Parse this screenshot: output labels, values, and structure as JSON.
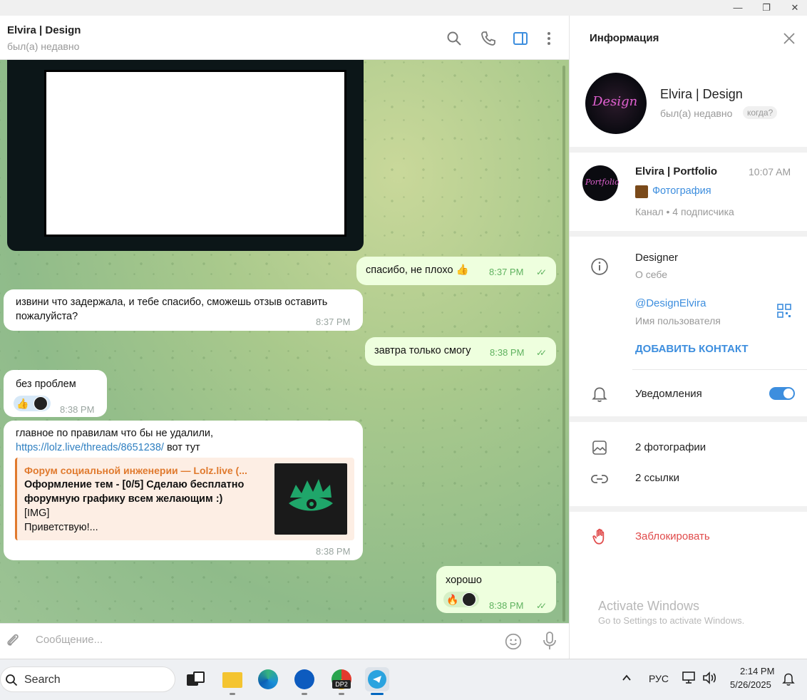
{
  "window": {
    "min": "—",
    "max": "❐",
    "close": "✕"
  },
  "chat": {
    "name": "Elvira | Design",
    "status": "был(а) недавно",
    "composer_placeholder": "Сообщение..."
  },
  "messages": [
    {
      "id": "m1",
      "dir": "out",
      "text": "спасибо, не плохо 👍",
      "time": "8:37 PM"
    },
    {
      "id": "m2",
      "dir": "in",
      "text_line1": "извини что задержала, и тебе спасибо, сможешь отзыв оставить",
      "text_line2": "пожалуйста?",
      "time": "8:37 PM"
    },
    {
      "id": "m3",
      "dir": "out",
      "text": "завтра только смогу",
      "time": "8:38 PM"
    },
    {
      "id": "m4",
      "dir": "in",
      "text": "без проблем",
      "reaction": "👍",
      "time": "8:38 PM"
    },
    {
      "id": "m5",
      "dir": "in",
      "text_line1": "главное по правилам что бы не удалили,",
      "link": "https://lolz.live/threads/8651238/",
      "link_suffix": " вот тут",
      "preview_site": "Форум социальной инженерии — Lolz.live (...",
      "preview_title_1": "Оформление тем - [0/5] Сделаю бесплатно",
      "preview_title_2": "форумную графику всем желающим :)",
      "preview_text_1": "[IMG]",
      "preview_text_2": "Приветствую!...",
      "time": "8:38 PM"
    },
    {
      "id": "m6",
      "dir": "out",
      "text": "хорошо",
      "reaction": "🔥",
      "time": "8:38 PM"
    }
  ],
  "info": {
    "title": "Информация",
    "name": "Elvira | Design",
    "status": "был(а) недавно",
    "when_badge": "когда?",
    "avatar_text": "Design",
    "channel": {
      "name": "Elvira | Portfolio",
      "time": "10:07 AM",
      "avatar_text": "Portfolio",
      "last_post": "Фотография",
      "meta": "Канал • 4 подписчика"
    },
    "bio": "Designer",
    "bio_label": "О себе",
    "username": "@DesignElvira",
    "username_label": "Имя пользователя",
    "add_contact": "ДОБАВИТЬ КОНТАКТ",
    "notifications": "Уведомления",
    "notifications_on": true,
    "photos": "2 фотографии",
    "links": "2 ссылки",
    "block": "Заблокировать",
    "watermark_1": "Activate Windows",
    "watermark_2": "Go to Settings to activate Windows."
  },
  "taskbar": {
    "search": "Search",
    "lang": "РУС",
    "time": "2:14 PM",
    "date": "5/26/2025",
    "dp2_label": "DP2"
  },
  "colors": {
    "accent": "#3d8ede",
    "out_bubble": "#eeffde",
    "danger": "#e04b4b",
    "link_preview": "#e07a2e"
  }
}
